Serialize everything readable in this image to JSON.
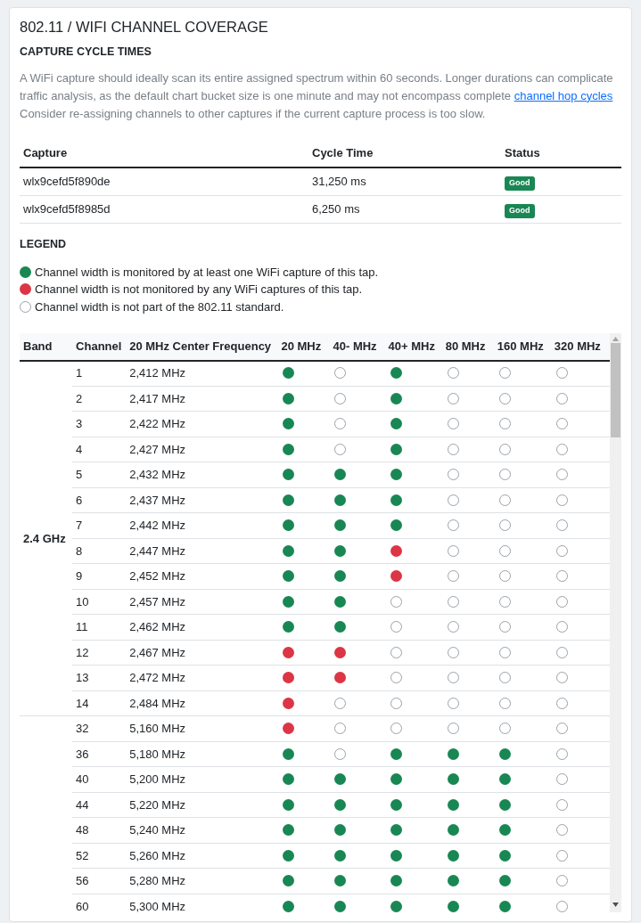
{
  "title": "802.11 / WIFI CHANNEL COVERAGE",
  "cycle_section": {
    "heading": "CAPTURE CYCLE TIMES",
    "description": "A WiFi capture should ideally scan its entire assigned spectrum within 60 seconds. Longer durations can complicate traffic analysis, as the default chart bucket size is one minute and may not encompass complete ",
    "link": "channel hop cycles",
    "description_after": "Consider re-assigning channels to other captures if the current capture process is too slow."
  },
  "captures_table": {
    "columns": [
      "Capture",
      "Cycle Time",
      "Status"
    ],
    "rows": [
      {
        "capture": "wlx9cefd5f890de",
        "cycle_time": "31,250 ms",
        "status": "Good"
      },
      {
        "capture": "wlx9cefd5f8985d",
        "cycle_time": "6,250 ms",
        "status": "Good"
      }
    ]
  },
  "legend": {
    "heading": "LEGEND",
    "items": [
      {
        "standard": true,
        "monitored": true,
        "text": "Channel width is monitored by at least one WiFi capture of this tap."
      },
      {
        "standard": true,
        "monitored": false,
        "text": "Channel width is not monitored by any WiFi captures of this tap."
      },
      {
        "standard": false,
        "text": "Channel width is not part of the 802.11 standard."
      }
    ]
  },
  "coverage_table": {
    "columns": [
      "Band",
      "Channel",
      "20 MHz Center Frequency",
      "20 MHz",
      "40- MHz",
      "40+ MHz",
      "80 MHz",
      "160 MHz",
      "320 MHz"
    ],
    "bands": [
      {
        "band": "2.4 GHz",
        "rows": [
          {
            "channel": "1",
            "frequency": "2,412 MHz",
            "widths": [
              {
                "standard": true,
                "monitored": true
              },
              {
                "standard": false
              },
              {
                "standard": true,
                "monitored": true
              },
              {
                "standard": false
              },
              {
                "standard": false
              },
              {
                "standard": false
              }
            ]
          },
          {
            "channel": "2",
            "frequency": "2,417 MHz",
            "widths": [
              {
                "standard": true,
                "monitored": true
              },
              {
                "standard": false
              },
              {
                "standard": true,
                "monitored": true
              },
              {
                "standard": false
              },
              {
                "standard": false
              },
              {
                "standard": false
              }
            ]
          },
          {
            "channel": "3",
            "frequency": "2,422 MHz",
            "widths": [
              {
                "standard": true,
                "monitored": true
              },
              {
                "standard": false
              },
              {
                "standard": true,
                "monitored": true
              },
              {
                "standard": false
              },
              {
                "standard": false
              },
              {
                "standard": false
              }
            ]
          },
          {
            "channel": "4",
            "frequency": "2,427 MHz",
            "widths": [
              {
                "standard": true,
                "monitored": true
              },
              {
                "standard": false
              },
              {
                "standard": true,
                "monitored": true
              },
              {
                "standard": false
              },
              {
                "standard": false
              },
              {
                "standard": false
              }
            ]
          },
          {
            "channel": "5",
            "frequency": "2,432 MHz",
            "widths": [
              {
                "standard": true,
                "monitored": true
              },
              {
                "standard": true,
                "monitored": true
              },
              {
                "standard": true,
                "monitored": true
              },
              {
                "standard": false
              },
              {
                "standard": false
              },
              {
                "standard": false
              }
            ]
          },
          {
            "channel": "6",
            "frequency": "2,437 MHz",
            "widths": [
              {
                "standard": true,
                "monitored": true
              },
              {
                "standard": true,
                "monitored": true
              },
              {
                "standard": true,
                "monitored": true
              },
              {
                "standard": false
              },
              {
                "standard": false
              },
              {
                "standard": false
              }
            ]
          },
          {
            "channel": "7",
            "frequency": "2,442 MHz",
            "widths": [
              {
                "standard": true,
                "monitored": true
              },
              {
                "standard": true,
                "monitored": true
              },
              {
                "standard": true,
                "monitored": true
              },
              {
                "standard": false
              },
              {
                "standard": false
              },
              {
                "standard": false
              }
            ]
          },
          {
            "channel": "8",
            "frequency": "2,447 MHz",
            "widths": [
              {
                "standard": true,
                "monitored": true
              },
              {
                "standard": true,
                "monitored": true
              },
              {
                "standard": true,
                "monitored": false
              },
              {
                "standard": false
              },
              {
                "standard": false
              },
              {
                "standard": false
              }
            ]
          },
          {
            "channel": "9",
            "frequency": "2,452 MHz",
            "widths": [
              {
                "standard": true,
                "monitored": true
              },
              {
                "standard": true,
                "monitored": true
              },
              {
                "standard": true,
                "monitored": false
              },
              {
                "standard": false
              },
              {
                "standard": false
              },
              {
                "standard": false
              }
            ]
          },
          {
            "channel": "10",
            "frequency": "2,457 MHz",
            "widths": [
              {
                "standard": true,
                "monitored": true
              },
              {
                "standard": true,
                "monitored": true
              },
              {
                "standard": false
              },
              {
                "standard": false
              },
              {
                "standard": false
              },
              {
                "standard": false
              }
            ]
          },
          {
            "channel": "11",
            "frequency": "2,462 MHz",
            "widths": [
              {
                "standard": true,
                "monitored": true
              },
              {
                "standard": true,
                "monitored": true
              },
              {
                "standard": false
              },
              {
                "standard": false
              },
              {
                "standard": false
              },
              {
                "standard": false
              }
            ]
          },
          {
            "channel": "12",
            "frequency": "2,467 MHz",
            "widths": [
              {
                "standard": true,
                "monitored": false
              },
              {
                "standard": true,
                "monitored": false
              },
              {
                "standard": false
              },
              {
                "standard": false
              },
              {
                "standard": false
              },
              {
                "standard": false
              }
            ]
          },
          {
            "channel": "13",
            "frequency": "2,472 MHz",
            "widths": [
              {
                "standard": true,
                "monitored": false
              },
              {
                "standard": true,
                "monitored": false
              },
              {
                "standard": false
              },
              {
                "standard": false
              },
              {
                "standard": false
              },
              {
                "standard": false
              }
            ]
          },
          {
            "channel": "14",
            "frequency": "2,484 MHz",
            "widths": [
              {
                "standard": true,
                "monitored": false
              },
              {
                "standard": false
              },
              {
                "standard": false
              },
              {
                "standard": false
              },
              {
                "standard": false
              },
              {
                "standard": false
              }
            ]
          }
        ]
      },
      {
        "rows": [
          {
            "channel": "32",
            "frequency": "5,160 MHz",
            "widths": [
              {
                "standard": true,
                "monitored": false
              },
              {
                "standard": false
              },
              {
                "standard": false
              },
              {
                "standard": false
              },
              {
                "standard": false
              },
              {
                "standard": false
              }
            ]
          },
          {
            "channel": "36",
            "frequency": "5,180 MHz",
            "widths": [
              {
                "standard": true,
                "monitored": true
              },
              {
                "standard": false
              },
              {
                "standard": true,
                "monitored": true
              },
              {
                "standard": true,
                "monitored": true
              },
              {
                "standard": true,
                "monitored": true
              },
              {
                "standard": false
              }
            ]
          },
          {
            "channel": "40",
            "frequency": "5,200 MHz",
            "widths": [
              {
                "standard": true,
                "monitored": true
              },
              {
                "standard": true,
                "monitored": true
              },
              {
                "standard": true,
                "monitored": true
              },
              {
                "standard": true,
                "monitored": true
              },
              {
                "standard": true,
                "monitored": true
              },
              {
                "standard": false
              }
            ]
          },
          {
            "channel": "44",
            "frequency": "5,220 MHz",
            "widths": [
              {
                "standard": true,
                "monitored": true
              },
              {
                "standard": true,
                "monitored": true
              },
              {
                "standard": true,
                "monitored": true
              },
              {
                "standard": true,
                "monitored": true
              },
              {
                "standard": true,
                "monitored": true
              },
              {
                "standard": false
              }
            ]
          },
          {
            "channel": "48",
            "frequency": "5,240 MHz",
            "widths": [
              {
                "standard": true,
                "monitored": true
              },
              {
                "standard": true,
                "monitored": true
              },
              {
                "standard": true,
                "monitored": true
              },
              {
                "standard": true,
                "monitored": true
              },
              {
                "standard": true,
                "monitored": true
              },
              {
                "standard": false
              }
            ]
          },
          {
            "channel": "52",
            "frequency": "5,260 MHz",
            "widths": [
              {
                "standard": true,
                "monitored": true
              },
              {
                "standard": true,
                "monitored": true
              },
              {
                "standard": true,
                "monitored": true
              },
              {
                "standard": true,
                "monitored": true
              },
              {
                "standard": true,
                "monitored": true
              },
              {
                "standard": false
              }
            ]
          },
          {
            "channel": "56",
            "frequency": "5,280 MHz",
            "widths": [
              {
                "standard": true,
                "monitored": true
              },
              {
                "standard": true,
                "monitored": true
              },
              {
                "standard": true,
                "monitored": true
              },
              {
                "standard": true,
                "monitored": true
              },
              {
                "standard": true,
                "monitored": true
              },
              {
                "standard": false
              }
            ]
          },
          {
            "channel": "60",
            "frequency": "5,300 MHz",
            "widths": [
              {
                "standard": true,
                "monitored": true
              },
              {
                "standard": true,
                "monitored": true
              },
              {
                "standard": true,
                "monitored": true
              },
              {
                "standard": true,
                "monitored": true
              },
              {
                "standard": true,
                "monitored": true
              },
              {
                "standard": false
              }
            ]
          }
        ]
      }
    ]
  }
}
